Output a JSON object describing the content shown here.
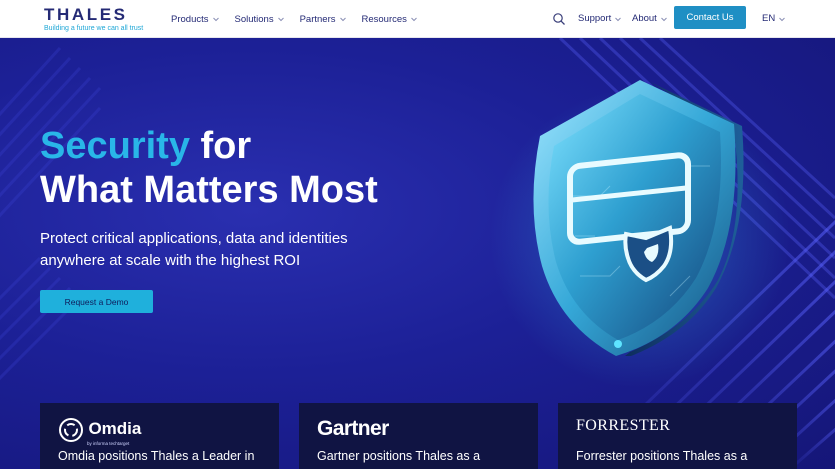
{
  "brand": {
    "name": "THALES",
    "tagline_part1": "Building a future ",
    "tagline_part2": "we can all trust"
  },
  "nav": {
    "items": [
      {
        "label": "Products"
      },
      {
        "label": "Solutions"
      },
      {
        "label": "Partners"
      },
      {
        "label": "Resources"
      }
    ],
    "support_label": "Support",
    "about_label": "About",
    "contact_label": "Contact Us",
    "language": "EN"
  },
  "hero": {
    "headline_accent": "Security",
    "headline_rest1": " for",
    "headline_line2": "What Matters Most",
    "subtext_line1": "Protect critical applications, data and identities",
    "subtext_line2": "anywhere at scale with the highest ROI",
    "cta_label": "Request a Demo"
  },
  "cards": [
    {
      "brand": "Omdia",
      "brand_sub": "by informa techtarget",
      "text": "Omdia positions Thales a Leader in"
    },
    {
      "brand": "Gartner",
      "text": "Gartner positions Thales as a"
    },
    {
      "brand": "FORRESTER",
      "text": "Forrester positions Thales as a"
    }
  ],
  "colors": {
    "accent": "#29b6e8",
    "brand_navy": "#242a75",
    "contact_button": "#1f8fc4",
    "hero_bg": "#1c2096",
    "card_bg": "#101443"
  },
  "icons": {
    "search": "search-icon",
    "dropdown": "chevron-down-icon",
    "shield": "shield-icon"
  }
}
